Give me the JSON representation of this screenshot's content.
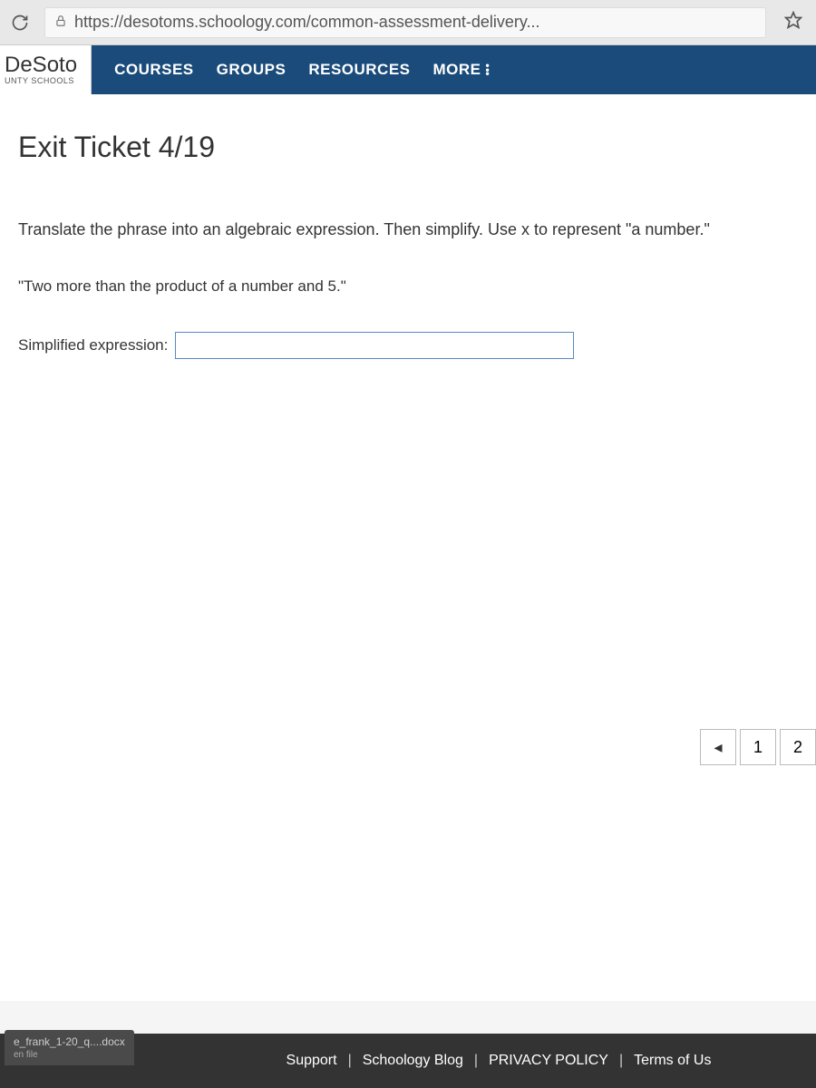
{
  "browser": {
    "url": "https://desotoms.schoology.com/common-assessment-delivery..."
  },
  "logo": {
    "main": "DeSoto",
    "sub": "UNTY SCHOOLS"
  },
  "nav": {
    "courses": "COURSES",
    "groups": "GROUPS",
    "resources": "RESOURCES",
    "more": "MORE"
  },
  "page": {
    "title": "Exit Ticket 4/19",
    "instruction": "Translate the phrase into an algebraic expression. Then simplify. Use x to represent \"a number.\"",
    "phrase": "\"Two more than the product of a number and 5.\"",
    "answer_label": "Simplified expression:",
    "answer_value": ""
  },
  "pager": {
    "prev": "◂",
    "one": "1",
    "two": "2"
  },
  "download": {
    "filename": "e_frank_1-20_q....docx",
    "sub": "en file"
  },
  "footer": {
    "support": "Support",
    "blog": "Schoology Blog",
    "privacy": "PRIVACY POLICY",
    "terms": "Terms of Us"
  }
}
